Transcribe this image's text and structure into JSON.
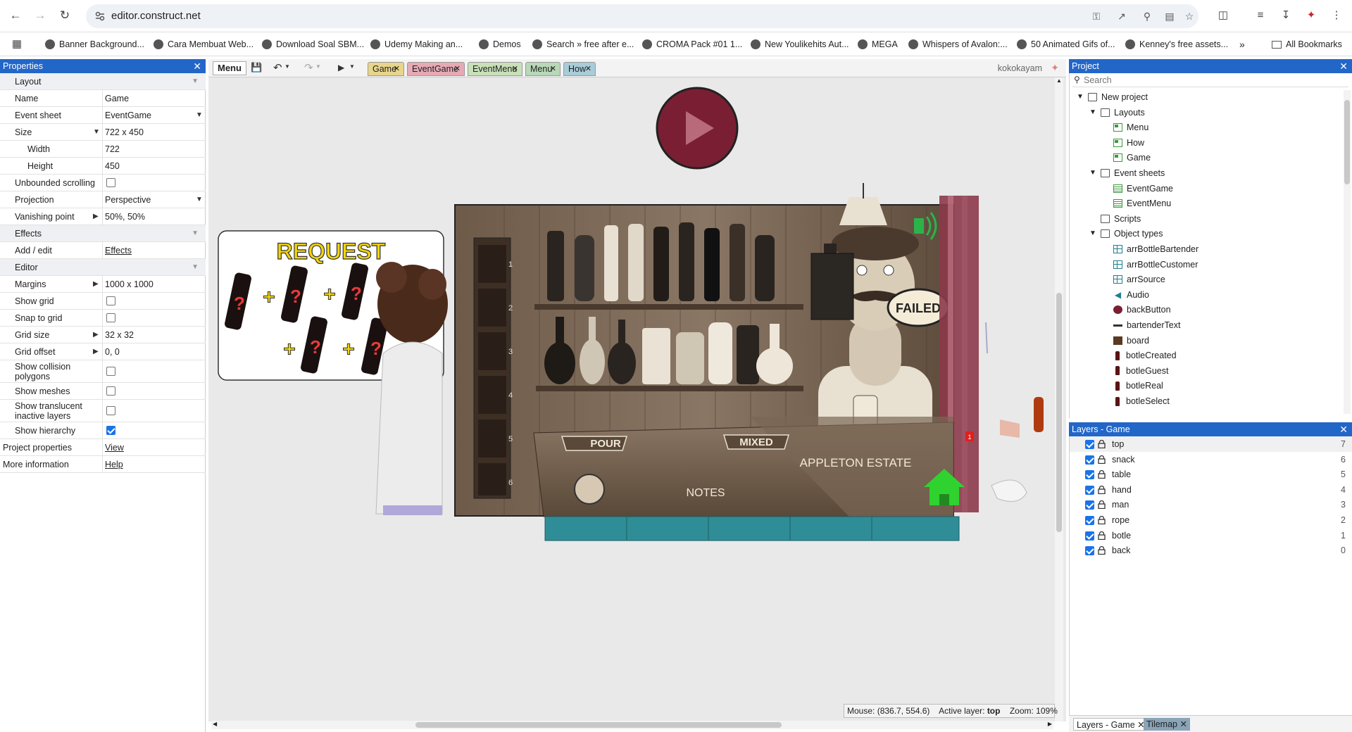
{
  "browser": {
    "url": "editor.construct.net",
    "bookmarks": [
      "Banner Background...",
      "Cara Membuat Web...",
      "Download Soal SBM...",
      "Udemy Making an...",
      "Demos",
      "Search » free after e...",
      "CROMA Pack #01 1...",
      "New Youlikehits Aut...",
      "MEGA",
      "Whispers of Avalon:...",
      "50 Animated Gifs of...",
      "Kenney's free assets..."
    ],
    "all_bookmarks": "All Bookmarks"
  },
  "properties": {
    "title": "Properties",
    "rows": [
      {
        "k": "Layout",
        "type": "sec"
      },
      {
        "k": "Name",
        "v": "Game"
      },
      {
        "k": "Event sheet",
        "v": "EventGame",
        "dropdown": true
      },
      {
        "k": "Size",
        "v": "722 x 450",
        "expand": true
      },
      {
        "k": "Width",
        "v": "722",
        "indent": true
      },
      {
        "k": "Height",
        "v": "450",
        "indent": true
      },
      {
        "k": "Unbounded scrolling",
        "cb": false
      },
      {
        "k": "Projection",
        "v": "Perspective",
        "dropdown": true
      },
      {
        "k": "Vanishing point",
        "v": "50%, 50%",
        "expand": true
      },
      {
        "k": "Effects",
        "type": "sec"
      },
      {
        "k": "Add / edit",
        "link": "Effects"
      },
      {
        "k": "Editor",
        "type": "sec"
      },
      {
        "k": "Margins",
        "v": "1000 x 1000",
        "expand": true
      },
      {
        "k": "Show grid",
        "cb": false
      },
      {
        "k": "Snap to grid",
        "cb": false
      },
      {
        "k": "Grid size",
        "v": "32 x 32",
        "expand": true
      },
      {
        "k": "Grid offset",
        "v": "0, 0",
        "expand": true
      },
      {
        "k": "Show collision polygons",
        "cb": false,
        "tall": true
      },
      {
        "k": "Show meshes",
        "cb": false
      },
      {
        "k": "Show translucent inactive layers",
        "cb": false,
        "tall": true
      },
      {
        "k": "Show hierarchy",
        "cb": true
      },
      {
        "k": "Project properties",
        "link": "View",
        "top": true
      },
      {
        "k": "More information",
        "link": "Help",
        "top": true
      }
    ]
  },
  "editor": {
    "menu_label": "Menu",
    "tabs": [
      {
        "label": "Game",
        "color": "#e8d58a"
      },
      {
        "label": "EventGame",
        "color": "#e6aab4"
      },
      {
        "label": "EventMenu",
        "color": "#c8e0b8"
      },
      {
        "label": "Menu",
        "color": "#b8d8b8"
      },
      {
        "label": "How",
        "color": "#a8ccd8"
      }
    ],
    "user": "kokokayam"
  },
  "game": {
    "request_title": "REQUEST",
    "failed": "FAILED",
    "pour": "POUR",
    "mixed": "MIXED",
    "brand": "APPLETON ESTATE",
    "notes": "NOTES",
    "shelf_numbers": [
      "1",
      "2",
      "3",
      "4",
      "5",
      "6"
    ],
    "badge": "1"
  },
  "status": {
    "mouse_label": "Mouse:",
    "mouse": "(836.7, 554.6)",
    "active_layer_label": "Active layer:",
    "active_layer": "top",
    "zoom_label": "Zoom:",
    "zoom": "109%"
  },
  "project": {
    "title": "Project",
    "search_placeholder": "Search",
    "tree": [
      {
        "label": "New project",
        "icon": "folder",
        "level": 0,
        "arrow": true
      },
      {
        "label": "Layouts",
        "icon": "folder",
        "level": 1,
        "arrow": true
      },
      {
        "label": "Menu",
        "icon": "layout",
        "level": 2
      },
      {
        "label": "How",
        "icon": "layout",
        "level": 2
      },
      {
        "label": "Game",
        "icon": "layout",
        "level": 2
      },
      {
        "label": "Event sheets",
        "icon": "folder",
        "level": 1,
        "arrow": true
      },
      {
        "label": "EventGame",
        "icon": "sheet",
        "level": 2
      },
      {
        "label": "EventMenu",
        "icon": "sheet",
        "level": 2
      },
      {
        "label": "Scripts",
        "icon": "folder",
        "level": 1
      },
      {
        "label": "Object types",
        "icon": "folder",
        "level": 1,
        "arrow": true
      },
      {
        "label": "arrBottleBartender",
        "icon": "arr",
        "level": 2
      },
      {
        "label": "arrBottleCustomer",
        "icon": "arr",
        "level": 2
      },
      {
        "label": "arrSource",
        "icon": "arr",
        "level": 2
      },
      {
        "label": "Audio",
        "icon": "audio",
        "level": 2
      },
      {
        "label": "backButton",
        "icon": "btn",
        "level": 2
      },
      {
        "label": "bartenderText",
        "icon": "txt",
        "level": 2
      },
      {
        "label": "board",
        "icon": "board",
        "level": 2
      },
      {
        "label": "botleCreated",
        "icon": "bottle",
        "level": 2
      },
      {
        "label": "botleGuest",
        "icon": "bottle",
        "level": 2
      },
      {
        "label": "botleReal",
        "icon": "bottle",
        "level": 2
      },
      {
        "label": "botleSelect",
        "icon": "bottle",
        "level": 2
      }
    ]
  },
  "layers": {
    "title": "Layers - Game",
    "items": [
      {
        "name": "top",
        "n": "7"
      },
      {
        "name": "snack",
        "n": "6"
      },
      {
        "name": "table",
        "n": "5"
      },
      {
        "name": "hand",
        "n": "4"
      },
      {
        "name": "man",
        "n": "3"
      },
      {
        "name": "rope",
        "n": "2"
      },
      {
        "name": "botle",
        "n": "1"
      },
      {
        "name": "back",
        "n": "0"
      }
    ]
  },
  "bottom_tabs": [
    "Layers - Game",
    "Tilemap"
  ]
}
